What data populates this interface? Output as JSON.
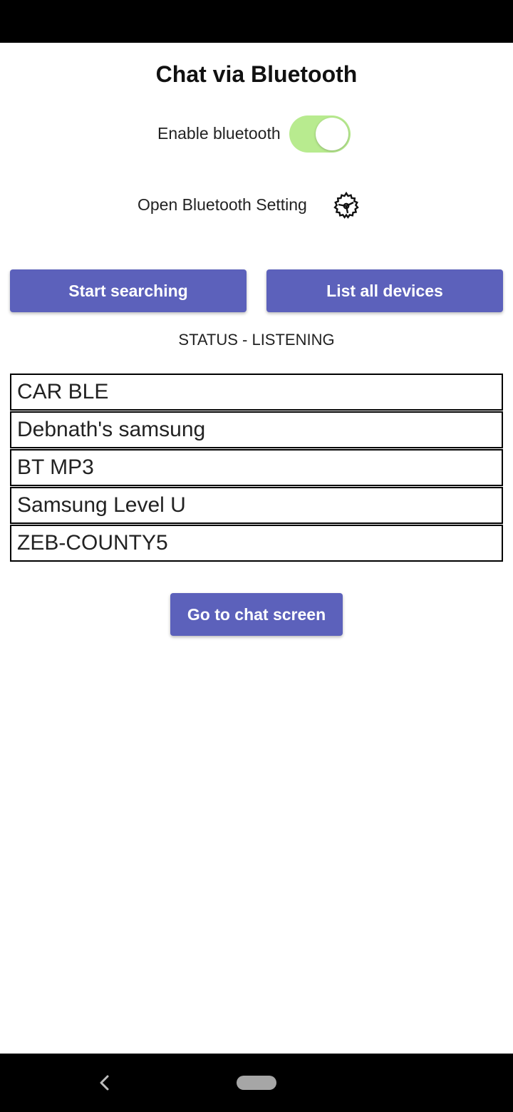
{
  "app": {
    "title": "Chat via Bluetooth"
  },
  "bluetooth_toggle": {
    "label": "Enable bluetooth",
    "enabled": true,
    "track_color": "#b8eb8f"
  },
  "settings": {
    "label": "Open Bluetooth Setting",
    "icon": "gear-icon"
  },
  "actions": {
    "start_searching": "Start searching",
    "list_all_devices": "List all devices",
    "go_to_chat": "Go to chat screen",
    "button_color": "#5c61bb"
  },
  "status": {
    "text": "STATUS - LISTENING"
  },
  "devices": [
    {
      "name": "CAR BLE"
    },
    {
      "name": "Debnath's samsung"
    },
    {
      "name": "BT MP3"
    },
    {
      "name": "Samsung Level U"
    },
    {
      "name": "ZEB-COUNTY5"
    }
  ],
  "navigation": {
    "back_icon": "chevron-left-icon",
    "home_icon": "home-pill-icon"
  }
}
